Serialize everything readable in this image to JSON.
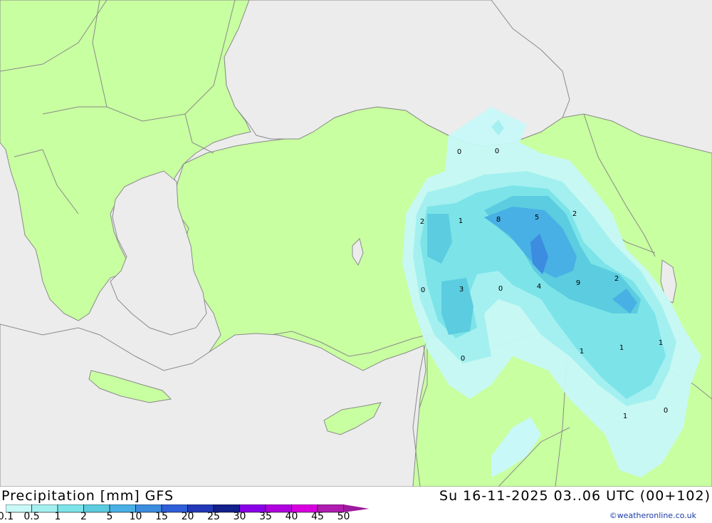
{
  "header": {
    "title": "Precipitation [mm] GFS",
    "datetime": "Su 16-11-2025 03..06 UTC (00+102)",
    "credit": "©weatheronline.co.uk"
  },
  "colors": {
    "land": "#c8ffa0",
    "sea": "#ececec",
    "border": "#8a8a8a"
  },
  "legend": {
    "ticks": [
      "0.1",
      "0.5",
      "1",
      "2",
      "5",
      "10",
      "15",
      "20",
      "25",
      "30",
      "35",
      "40",
      "45",
      "50"
    ],
    "colors": [
      "#c8f8f8",
      "#a4f0f0",
      "#7ce4e8",
      "#5ccce0",
      "#48b0e4",
      "#3c8ce0",
      "#2e5ed8",
      "#2238b8",
      "#14208c",
      "#8a00e8",
      "#b000e0",
      "#d800e0",
      "#b01cb0",
      "#9c1a9c"
    ]
  },
  "map_labels": [
    "0",
    "0",
    "2",
    "1",
    "8",
    "5",
    "2",
    "0",
    "3",
    "0",
    "4",
    "9",
    "2",
    "0",
    "1",
    "1",
    "1",
    "1",
    "0"
  ]
}
